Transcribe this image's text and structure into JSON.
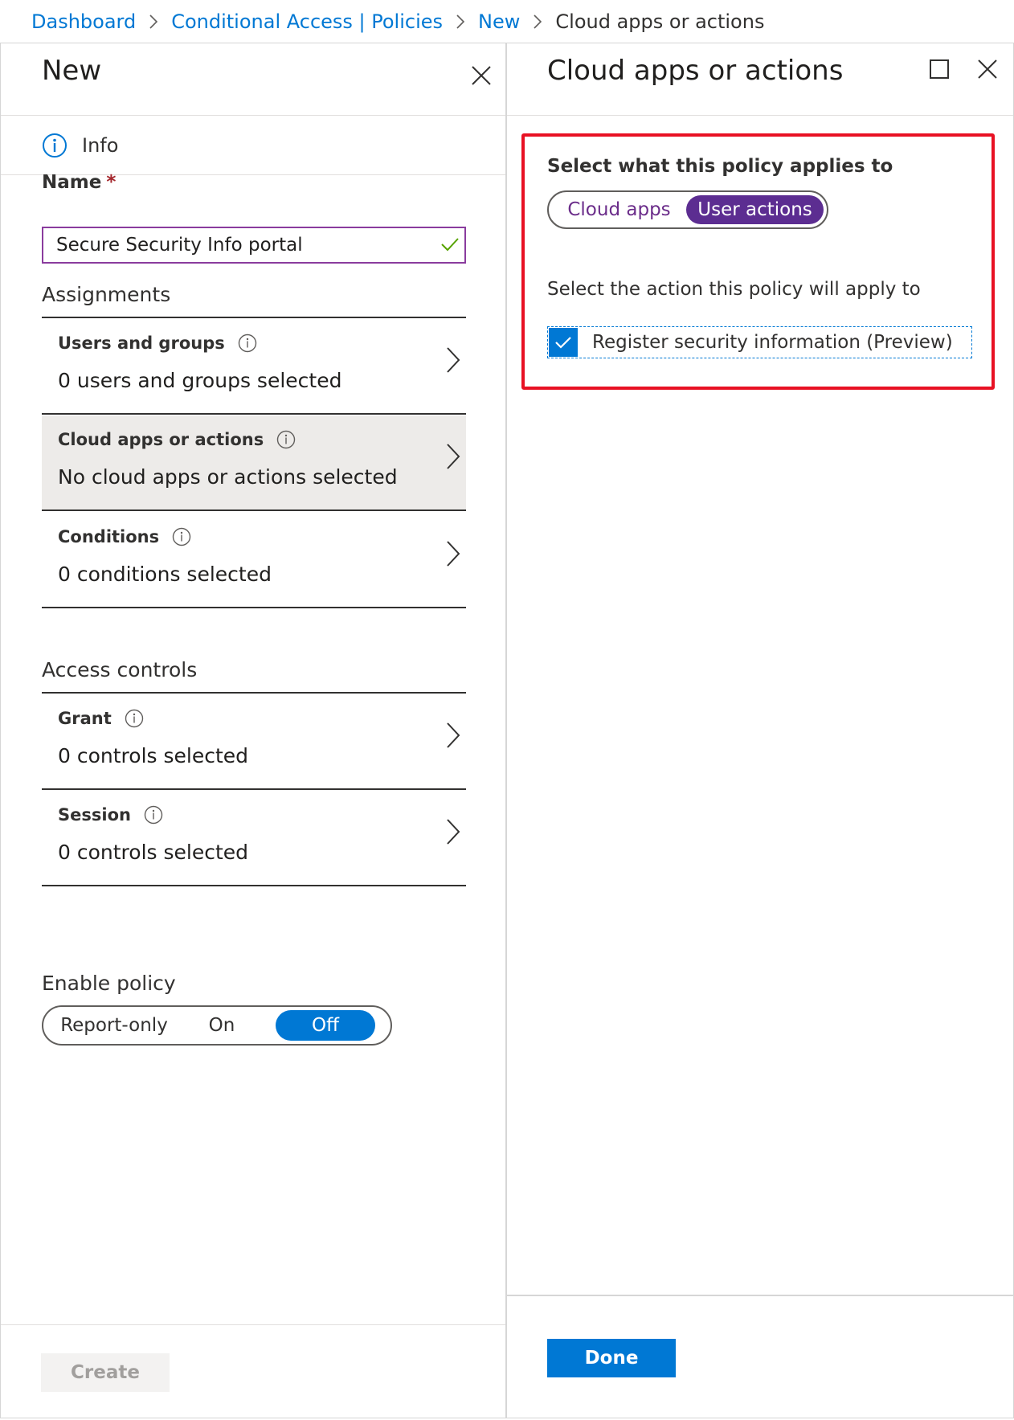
{
  "breadcrumb": {
    "items": [
      "Dashboard",
      "Conditional Access | Policies",
      "New"
    ],
    "current": "Cloud apps or actions"
  },
  "left_blade": {
    "title": "New",
    "info_label": "Info",
    "name_label": "Name",
    "required_marker": "*",
    "name_value": "Secure Security Info portal",
    "assignments_title": "Assignments",
    "assignments": [
      {
        "label": "Users and groups",
        "value": "0 users and groups selected"
      },
      {
        "label": "Cloud apps or actions",
        "value": "No cloud apps or actions selected"
      },
      {
        "label": "Conditions",
        "value": "0 conditions selected"
      }
    ],
    "access_controls_title": "Access controls",
    "access_controls": [
      {
        "label": "Grant",
        "value": "0 controls selected"
      },
      {
        "label": "Session",
        "value": "0 controls selected"
      }
    ],
    "enable_policy_label": "Enable policy",
    "enable_policy_options": [
      "Report-only",
      "On",
      "Off"
    ],
    "enable_policy_selected": "Off",
    "create_label": "Create"
  },
  "right_blade": {
    "title": "Cloud apps or actions",
    "applies_label": "Select what this policy applies to",
    "applies_options": [
      "Cloud apps",
      "User actions"
    ],
    "applies_selected": "User actions",
    "action_label": "Select the action this policy will apply to",
    "checkbox_label": "Register security information (Preview)",
    "checkbox_checked": true,
    "done_label": "Done"
  },
  "colors": {
    "accent": "#0078d4",
    "purple": "#5c2d91",
    "highlight": "#e81123",
    "required": "#a4262c",
    "valid": "#57a300"
  }
}
